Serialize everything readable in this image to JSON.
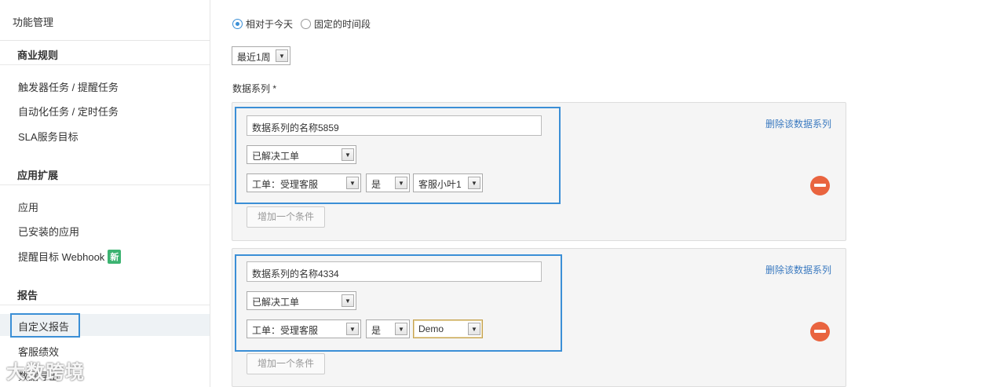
{
  "sidebar": {
    "top": "功能管理",
    "sections": [
      {
        "title": "商业规则",
        "items": [
          "触发器任务 / 提醒任务",
          "自动化任务 / 定时任务",
          "SLA服务目标"
        ]
      },
      {
        "title": "应用扩展",
        "items": [
          "应用",
          "已安装的应用",
          "提醒目标 Webhook"
        ],
        "badge": "新"
      },
      {
        "title": "报告",
        "items": [
          "自定义报告",
          "客服绩效",
          "数据导出"
        ]
      }
    ],
    "active_item": "自定义报告"
  },
  "watermark": "大数跨境",
  "main": {
    "radios": [
      {
        "label": "相对于今天",
        "checked": true
      },
      {
        "label": "固定的时间段",
        "checked": false
      }
    ],
    "period_select": "最近1周",
    "series_label": "数据系列 *",
    "series": [
      {
        "name": "数据系列的名称5859",
        "type": "已解决工单",
        "condition_field": "工单：受理客服",
        "operator": "是",
        "value": "客服小叶1",
        "delete_label": "删除该数据系列",
        "add_condition_label": "增加一个条件"
      },
      {
        "name": "数据系列的名称4334",
        "type": "已解决工单",
        "condition_field": "工单：受理客服",
        "operator": "是",
        "value": "Demo",
        "delete_label": "删除该数据系列",
        "add_condition_label": "增加一个条件"
      }
    ]
  },
  "colors": {
    "accent": "#3b8fd6",
    "danger": "#e9643f",
    "badge": "#3cb371",
    "link": "#3b7ac0"
  }
}
